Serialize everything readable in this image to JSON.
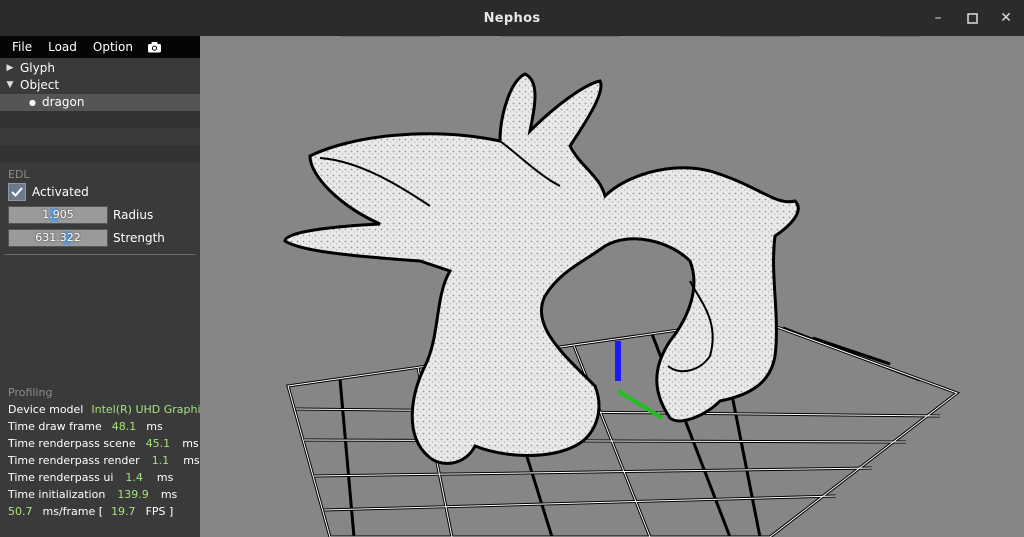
{
  "window": {
    "title": "Nephos",
    "minimize": "–",
    "maximize": "☐",
    "close": "✕"
  },
  "menu": {
    "file": "File",
    "load": "Load",
    "option": "Option",
    "camera_icon": "camera-icon"
  },
  "tree": {
    "glyph": {
      "label": "Glyph",
      "expanded": false
    },
    "object": {
      "label": "Object",
      "expanded": true
    },
    "child": {
      "label": "dragon"
    }
  },
  "edl": {
    "section": "EDL",
    "activated_label": "Activated",
    "activated": true,
    "radius": {
      "value": "1.905",
      "label": "Radius",
      "fill_fraction": 0.45
    },
    "strength": {
      "value": "631.322",
      "label": "Strength",
      "fill_fraction": 0.6
    }
  },
  "profiling": {
    "section": "Profiling",
    "device_label": "Device model",
    "device_value": "Intel(R) UHD Graphics",
    "draw_label": "Time draw frame",
    "draw_value": "48.1",
    "draw_unit": "ms",
    "scene_label": "Time renderpass scene",
    "scene_value": "45.1",
    "scene_unit": "ms",
    "render_label": "Time renderpass render",
    "render_value": "1.1",
    "render_unit": "ms",
    "ui_label": "Time renderpass ui",
    "ui_value": "1.4",
    "ui_unit": "ms",
    "init_label": "Time initialization",
    "init_value": "139.9",
    "init_unit": "ms",
    "frame_ms": "50.7",
    "frame_label": "ms/frame [",
    "fps": "19.7",
    "fps_label": "FPS ]"
  },
  "colors": {
    "accent": "#5b9bd5",
    "value_green": "#a6e27a",
    "viewport_bg": "#868686",
    "axis_y": "#1a1aff",
    "axis_z": "#1fbf1f"
  },
  "viewport": {
    "object_name": "dragon",
    "grid": true
  }
}
